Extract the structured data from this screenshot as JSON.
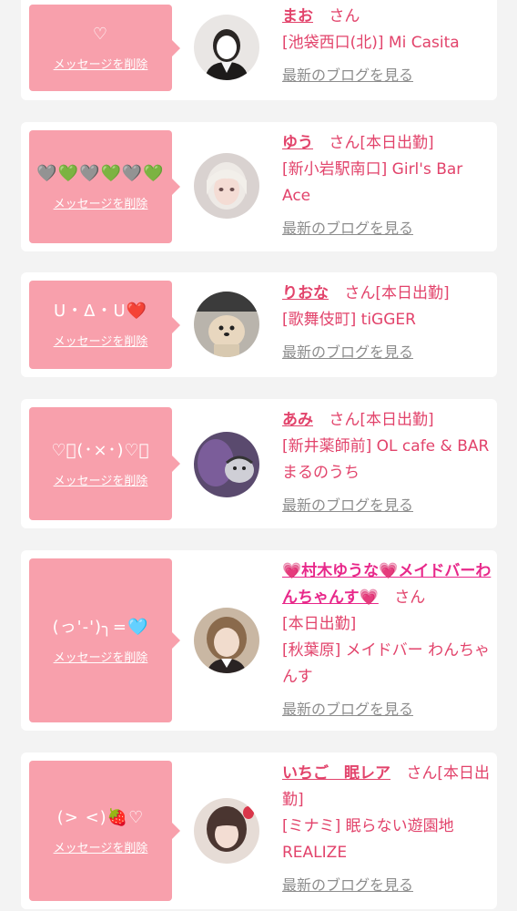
{
  "delete_label": "メッセージを削除",
  "blog_label": "最新のブログを見る",
  "san": "さん",
  "entries": [
    {
      "message": "♡",
      "name": "まお",
      "status": "",
      "shop": "[池袋西口(北)] Mi Casita"
    },
    {
      "message": "🩶💚🩶💚🩶💚",
      "name": "ゆう",
      "status": "[本日出勤]",
      "shop": "[新小岩駅南口] Girl's Bar Ace"
    },
    {
      "message": "ᑌ・ᐃ・ᑌ❤️",
      "name": "りおな",
      "status": "[本日出勤]",
      "shop": "[歌舞伎町] tiGGER"
    },
    {
      "message": "♡ͦ(･×･)♡ͦ",
      "name": "あみ",
      "status": "[本日出勤]",
      "shop": "[新井薬師前] OL cafe & BARまるのうち"
    },
    {
      "message": "(っ'-')╮=🩵",
      "name": "💗村木ゆうな💗メイドバーわんちゃんす💗",
      "status": "[本日出勤]",
      "shop": "[秋葉原] メイドバー わんちゃんす"
    },
    {
      "message": "(> <)🍓♡",
      "name": "いちご　眠レア",
      "status": "[本日出勤]",
      "shop": "[ミナミ] 眠らない遊園地REALIZE"
    }
  ],
  "colors": {
    "accent": "#e2436b",
    "bubble": "#f8a0ac",
    "background": "#f3f3f3"
  }
}
